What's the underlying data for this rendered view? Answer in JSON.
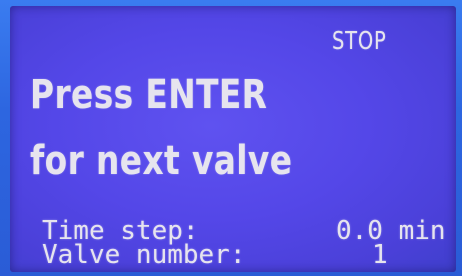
{
  "display": {
    "status": "STOP",
    "message_line1": "Press ENTER",
    "message_line2": "for next valve",
    "time_step": {
      "label": "Time step:",
      "value": "0.0 min"
    },
    "valve_number": {
      "label": "Valve number:",
      "value": "1"
    }
  },
  "colors": {
    "screen_background": "#5447e8",
    "bezel": "#2d66e0",
    "text": "#e6e4ee"
  }
}
